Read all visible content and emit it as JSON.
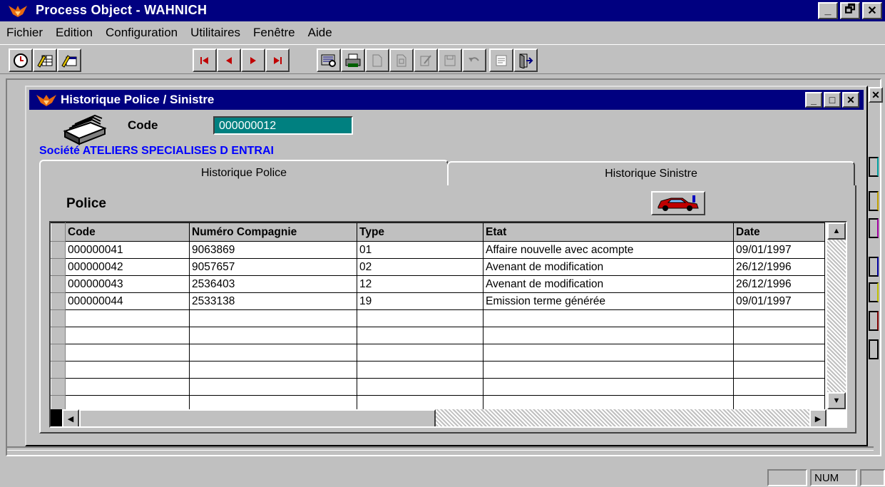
{
  "app": {
    "title": "Process Object - WAHNICH",
    "window_buttons": [
      "_",
      "🗗",
      "✕"
    ]
  },
  "menu": [
    {
      "label": "Fichier"
    },
    {
      "label": "Edition"
    },
    {
      "label": "Configuration"
    },
    {
      "label": "Utilitaires"
    },
    {
      "label": "Fenêtre"
    },
    {
      "label": "Aide"
    }
  ],
  "toolbar": {
    "left_icons": [
      "clock-icon",
      "edit-table-icon",
      "edit-window-icon"
    ],
    "nav_icons": [
      "first-record-icon",
      "previous-record-icon",
      "next-record-icon",
      "last-record-icon"
    ],
    "action_icons": [
      "search-icon",
      "print-icon",
      "new-document-icon",
      "copy-document-icon",
      "edit-document-icon",
      "save-icon",
      "undo-icon",
      "properties-icon",
      "exit-icon"
    ]
  },
  "child_window": {
    "title": "Historique Police / Sinistre",
    "window_buttons": [
      "_",
      "□",
      "✕"
    ],
    "code_label": "Code",
    "code_value": "000000012",
    "societe": "Société ATELIERS SPECIALISES D ENTRAI",
    "tabs": [
      {
        "label": "Historique Police",
        "active": true
      },
      {
        "label": "Historique Sinistre",
        "active": false
      }
    ],
    "section_label": "Police"
  },
  "grid": {
    "columns": [
      "Code",
      "Numéro Compagnie",
      "Type",
      "Etat",
      "Date"
    ],
    "rows": [
      [
        "000000041",
        "9063869",
        "01",
        "Affaire nouvelle avec acompte",
        "09/01/1997"
      ],
      [
        "000000042",
        "9057657",
        "02",
        "Avenant de modification",
        "26/12/1996"
      ],
      [
        "000000043",
        "2536403",
        "12",
        "Avenant de modification",
        "26/12/1996"
      ],
      [
        "000000044",
        "2533138",
        "19",
        "Emission terme générée",
        "09/01/1997"
      ]
    ],
    "empty_rows": 6
  },
  "status": {
    "num": "NUM"
  },
  "colors": {
    "titlebar": "#000080",
    "face": "#c0c0c0",
    "code_field": "#008080",
    "societe_text": "#0000ff"
  }
}
